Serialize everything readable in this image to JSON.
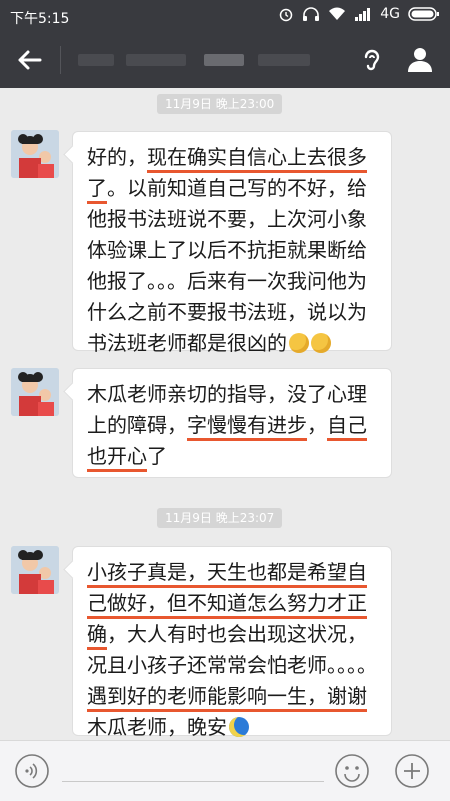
{
  "status_bar": {
    "time": "下午5:15",
    "network": "4G",
    "icons": [
      "alarm-icon",
      "headphones-icon",
      "wifi-icon",
      "signal-icon",
      "battery-icon"
    ]
  },
  "nav": {
    "back_icon": "back-arrow-icon",
    "earpiece_icon": "ear-icon",
    "profile_icon": "person-icon"
  },
  "messages": [
    {
      "timestamp": "11月9日 晚上23:00",
      "text_1": "好的，",
      "highlight_1": "现在确实自信心上去很多了",
      "text_2": "。以前知道自己写的不好，给他报书法班说不要，上次河小象体验课上了以后不抗拒就果断给他报了。。。后来有一次我问他为什么之前不要报书法班，说以为书法班老师都是很凶的",
      "emojis": [
        "thinking-emoji",
        "thinking-emoji"
      ]
    },
    {
      "text_1": "木瓜老师亲切的指导，没了心理上的障碍，",
      "highlight_1": "字慢慢有进步",
      "text_2": "，",
      "highlight_2": "自己也开心",
      "text_3": "了"
    },
    {
      "timestamp": "11月9日 晚上23:07",
      "highlight_1": "小孩子真是，天生也都是希望自己做好，但不知道怎么努力才正确",
      "text_1": "，大人有时也会出现这状况，况且小孩子还常常会怕老师。。。。",
      "highlight_2": "遇到好的老师能影响一生，谢谢木瓜老师",
      "text_2": "，晚安",
      "emojis": [
        "moon-emoji"
      ]
    }
  ],
  "input_bar": {
    "voice_icon": "voice-icon",
    "emoji_icon": "emoji-face-icon",
    "plus_icon": "plus-icon",
    "value": ""
  },
  "colors": {
    "header": "#393a3f",
    "chat_background": "#ebebeb",
    "underline": "#e8572f",
    "bubble": "#ffffff"
  }
}
